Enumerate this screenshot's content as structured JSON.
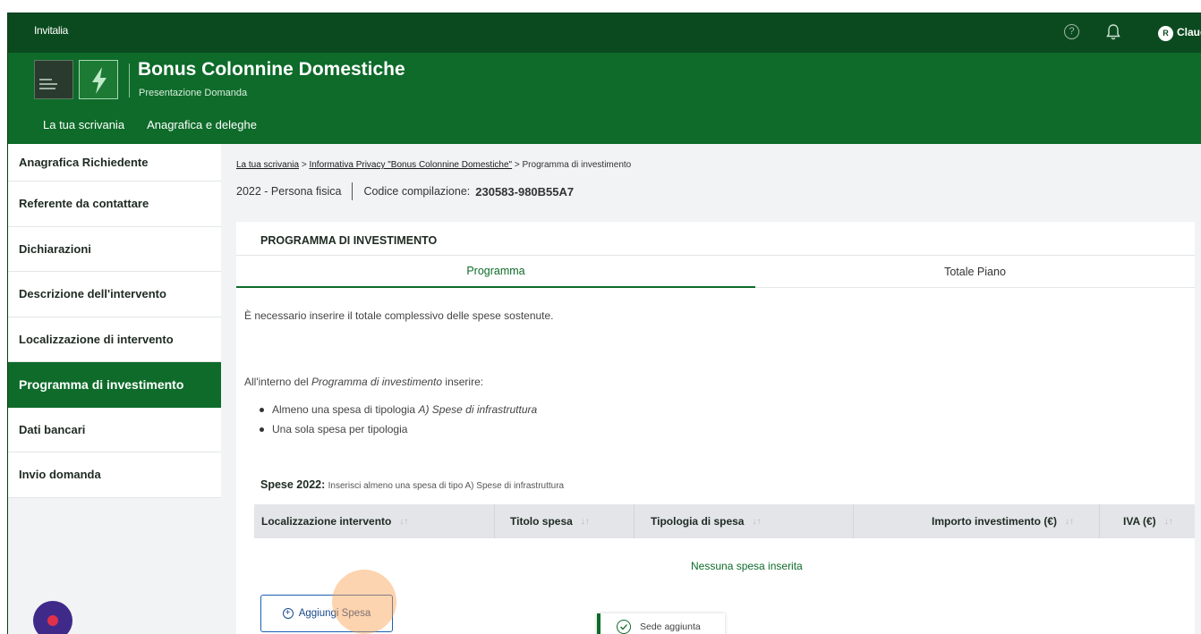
{
  "topbar": {
    "brand": "Invitalia",
    "help_icon": "question-circle-icon",
    "notifications_icon": "bell-icon",
    "avatar_initial": "R",
    "user_name": "Claud"
  },
  "header": {
    "app_title": "Bonus Colonnine Domestiche",
    "app_subtitle": "Presentazione Domanda",
    "logo_icon": "lightning-bolt-icon",
    "nav": [
      "La tua scrivania",
      "Anagrafica e deleghe"
    ]
  },
  "sidebar": {
    "items": [
      {
        "label": "Anagrafica Richiedente"
      },
      {
        "label": "Referente da contattare"
      },
      {
        "label": "Dichiarazioni"
      },
      {
        "label": "Descrizione dell'intervento"
      },
      {
        "label": "Localizzazione di intervento"
      },
      {
        "label": "Programma di investimento",
        "active": true
      },
      {
        "label": "Dati bancari"
      },
      {
        "label": "Invio domanda"
      }
    ]
  },
  "breadcrumb": {
    "item1": "La tua scrivania",
    "sep": ">",
    "item2": "Informativa Privacy \"Bonus Colonnine Domestiche\"",
    "current": "Programma di investimento"
  },
  "meta": {
    "year_type": "2022 - Persona fisica",
    "code_label": "Codice compilazione:",
    "code_value": "230583-980B55A7"
  },
  "card": {
    "title": "PROGRAMMA DI INVESTIMENTO",
    "tabs": [
      "Programma",
      "Totale Piano"
    ],
    "paragraph1": "È necessario inserire il totale complessivo delle spese sostenute.",
    "paragraph2_before": "All'interno del ",
    "paragraph2_italic": "Programma di investimento",
    "paragraph2_after": " inserire:",
    "bullet1_before": "Almeno una spesa di tipologia ",
    "bullet1_italic": "A) Spese di infrastruttura",
    "bullet2": "Una sola spesa per tipologia",
    "spese_label": "Spese 2022:",
    "spese_hint": "Inserisci almeno una spesa di tipo A) Spese di infrastruttura",
    "table_headers": [
      "Localizzazione intervento",
      "Titolo spesa",
      "Tipologia di spesa",
      "Importo investimento (€)",
      "IVA (€)"
    ],
    "sort_icon": "↓↑",
    "empty_text": "Nessuna spesa inserita",
    "add_button": "Aggiungi Spesa"
  },
  "toast": {
    "text": "Sede aggiunta",
    "icon": "check-circle-icon"
  },
  "colors": {
    "topbar": "#0b4a1f",
    "header": "#0e6b2a",
    "accent": "#0e6b2a",
    "button_border": "#1a5fb4"
  }
}
